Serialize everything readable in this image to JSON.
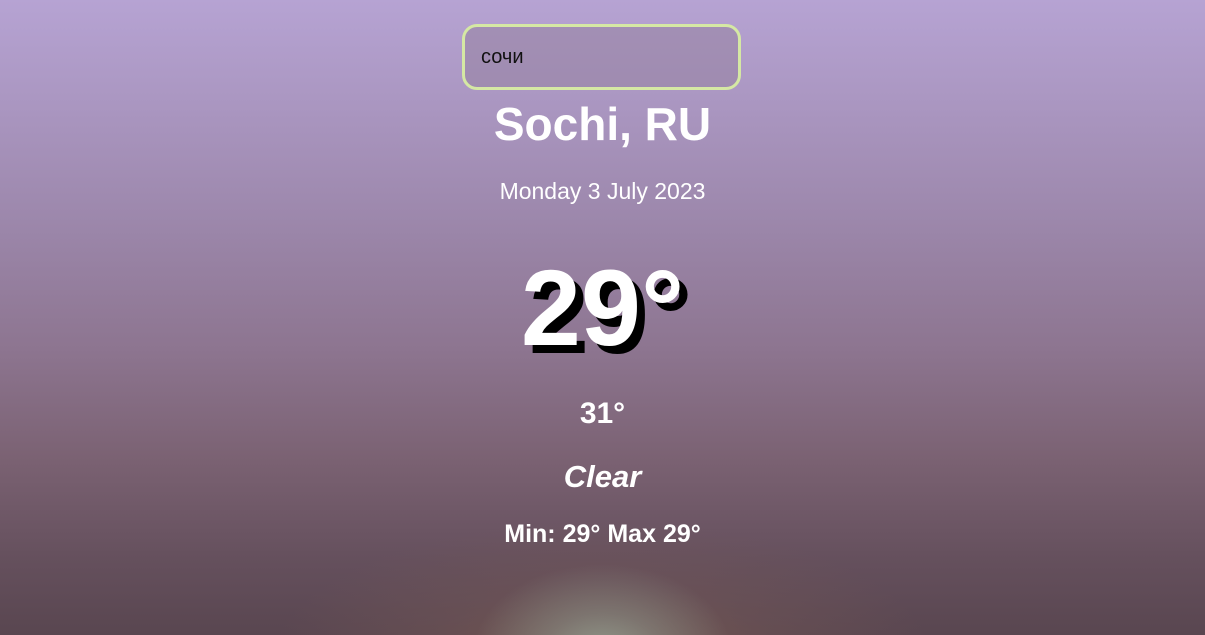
{
  "search": {
    "value": "сочи"
  },
  "weather": {
    "location": "Sochi, RU",
    "date": "Monday 3 July 2023",
    "temperature": "29°",
    "feels_like": "31°",
    "condition": "Clear",
    "min_label": "Min:",
    "min_value": "29°",
    "max_label": "Max",
    "max_value": "29°"
  },
  "colors": {
    "search_border": "#d5e8a4",
    "text": "#ffffff"
  }
}
